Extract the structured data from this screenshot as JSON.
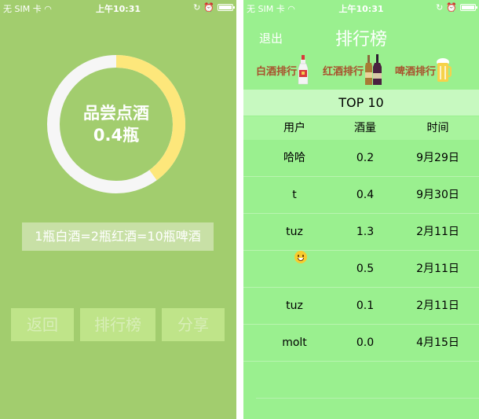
{
  "status_bar": {
    "carrier": "无 SIM 卡",
    "time": "上午10:31"
  },
  "left": {
    "ring": {
      "title": "品尝点酒",
      "value": "0.4瓶",
      "progress_fraction": 0.4,
      "fill_color": "#fde77b",
      "track_color": "#f6f6f6"
    },
    "conversion_text": "1瓶白酒=2瓶红酒=10瓶啤酒",
    "buttons": {
      "back": "返回",
      "ranking": "排行榜",
      "share": "分享"
    }
  },
  "right": {
    "nav": {
      "exit": "退出",
      "title": "排行榜"
    },
    "categories": {
      "baijiu": "白酒排行",
      "hongjiu": "红酒排行",
      "pijiu": "啤酒排行"
    },
    "top_label": "TOP 10",
    "table": {
      "headers": {
        "user": "用户",
        "amount": "酒量",
        "time": "时间"
      },
      "rows": [
        {
          "user": "哈哈",
          "amount": "0.2",
          "time": "9月29日"
        },
        {
          "user": "t",
          "amount": "0.4",
          "time": "9月30日"
        },
        {
          "user": "tuz",
          "amount": "1.3",
          "time": "2月11日"
        },
        {
          "user": "",
          "amount": "0.5",
          "time": "2月11日"
        },
        {
          "user": "tuz",
          "amount": "0.1",
          "time": "2月11日"
        },
        {
          "user": "molt",
          "amount": "0.0",
          "time": "4月15日"
        }
      ]
    }
  }
}
